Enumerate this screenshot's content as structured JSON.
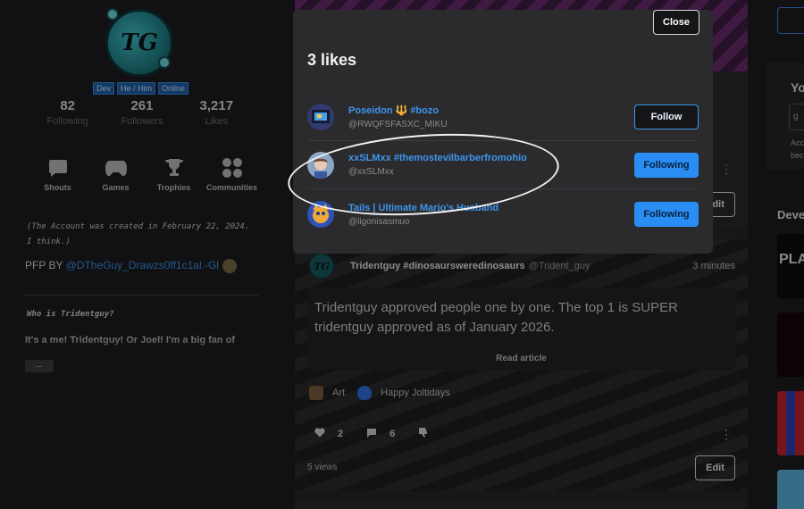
{
  "profile": {
    "avatar_text": "TG",
    "badges": [
      "Dev",
      "He / Him",
      "Online"
    ],
    "stats": [
      {
        "value": "82",
        "label": "Following"
      },
      {
        "value": "261",
        "label": "Followers"
      },
      {
        "value": "3,217",
        "label": "Likes"
      }
    ],
    "nav": [
      "Shouts",
      "Games",
      "Trophies",
      "Communities"
    ],
    "description": "(The Account was created in February 22, 2024. I think.)",
    "pfp_prefix": "PFP BY ",
    "pfp_link": "@DTheGuy_Drawzs0ff1c1al.-Gl",
    "who_heading": "Who is Tridentguy?",
    "intro": "It's a me! Tridentguy! Or Joel! I'm a big fan of",
    "more_label": "..."
  },
  "feed": {
    "top_card": {
      "edit_label": "Edit"
    },
    "post": {
      "avatar_text": "TG",
      "author": "Tridentguy #dinosaursweredinosaurs",
      "handle": "@Trident_guy",
      "time": "3 minutes",
      "text": "Tridentguy approved people one by one. The top 1 is SUPER tridentguy approved as of January 2026.",
      "read_article": "Read article",
      "tags": [
        "Art",
        "Happy Joltidays"
      ],
      "likes": "2",
      "comments": "6",
      "views": "5 views",
      "edit_label": "Edit"
    }
  },
  "right": {
    "heading_partial": "Yo",
    "input_partial": "g",
    "text_partial": [
      "Acc",
      "bec"
    ],
    "section_partial": "Deve",
    "thumb_text": "PLA"
  },
  "modal": {
    "close_label": "Close",
    "title": "3 likes",
    "users": [
      {
        "name": "Poseidon 🔱 #bozo",
        "handle": "@RWQFSFASXC_MIKU",
        "button": "Follow"
      },
      {
        "name": "xxSLMxx #themostevilbarberfromohio",
        "handle": "@xxSLMxx",
        "button": "Following"
      },
      {
        "name": "Tails | Ultimate Mario's Husband",
        "handle": "@ligonisasmuo",
        "button": "Following"
      }
    ]
  },
  "colors": {
    "accent": "#2a8df3",
    "link": "#3d95ec",
    "background": "#1c1c1f",
    "modal": "#2b2b2e"
  }
}
